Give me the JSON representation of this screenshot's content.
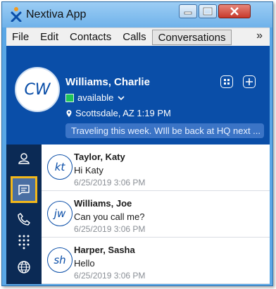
{
  "window": {
    "title": "Nextiva App"
  },
  "menu": {
    "items": [
      "File",
      "Edit",
      "Contacts",
      "Calls",
      "Conversations"
    ],
    "active": "Conversations",
    "overflow": "»"
  },
  "contact": {
    "initials": "CW",
    "name": "Williams, Charlie",
    "presence": "available",
    "presence_color": "#1ec45a",
    "location": "Scottsdale, AZ  1:19 PM",
    "status_message": "Traveling this week. WIll be back at HQ next ..."
  },
  "sidebar": {
    "items": [
      {
        "icon": "contacts-icon",
        "active": false
      },
      {
        "icon": "conversations-icon",
        "active": true
      },
      {
        "icon": "calls-icon",
        "active": false
      },
      {
        "icon": "dialpad-icon",
        "active": false
      },
      {
        "icon": "globe-icon",
        "active": false
      }
    ]
  },
  "conversations": [
    {
      "initials": "kt",
      "name": "Taylor, Katy",
      "message": "Hi Katy",
      "time": "6/25/2019 3:06 PM"
    },
    {
      "initials": "jw",
      "name": "Williams, Joe",
      "message": "Can you call me?",
      "time": "6/25/2019 3:06 PM"
    },
    {
      "initials": "sh",
      "name": "Harper, Sasha",
      "message": "Hello",
      "time": "6/25/2019 3:06 PM"
    }
  ],
  "colors": {
    "header": "#0a4ea8",
    "sidebar": "#0b2a55",
    "active_outline": "#f3b81a",
    "status_bubble": "#3b74c6"
  }
}
